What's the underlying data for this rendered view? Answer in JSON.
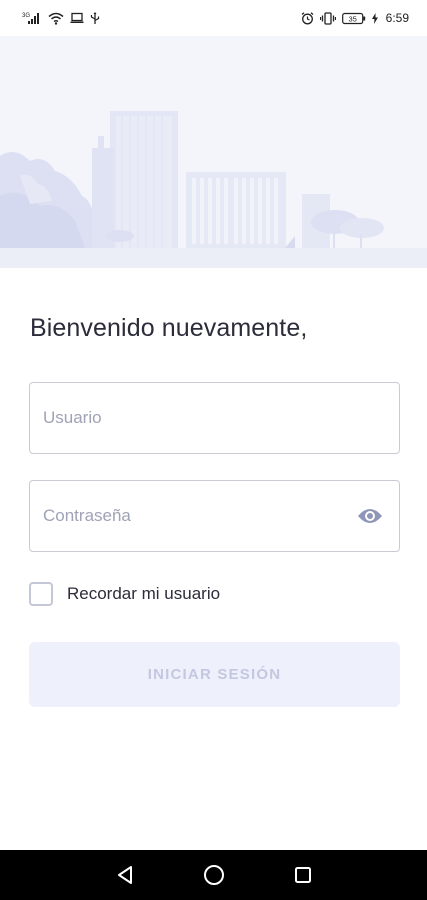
{
  "status_bar": {
    "network_label": "3G",
    "battery_level": "35",
    "time": "6:59",
    "icons": [
      "signal-icon",
      "wifi-icon",
      "laptop-icon",
      "usb-icon",
      "alarm-icon",
      "vibrate-icon",
      "battery-icon",
      "charging-icon"
    ]
  },
  "welcome": {
    "title": "Bienvenido nuevamente,"
  },
  "form": {
    "username_placeholder": "Usuario",
    "username_value": "",
    "password_placeholder": "Contraseña",
    "password_value": "",
    "remember_label": "Recordar mi usuario",
    "remember_checked": false,
    "submit_label": "INICIAR SESIÓN"
  },
  "colors": {
    "hero_background": "#f4f5fb",
    "illustration": "#dfe2f3",
    "button_disabled_bg": "#eef0fb",
    "button_disabled_text": "#c4c7e0",
    "field_border": "#c9cbd6",
    "eye_icon": "#8f97b8"
  },
  "nav_bar": {
    "icons": [
      "back-icon",
      "home-icon",
      "recents-icon"
    ]
  }
}
